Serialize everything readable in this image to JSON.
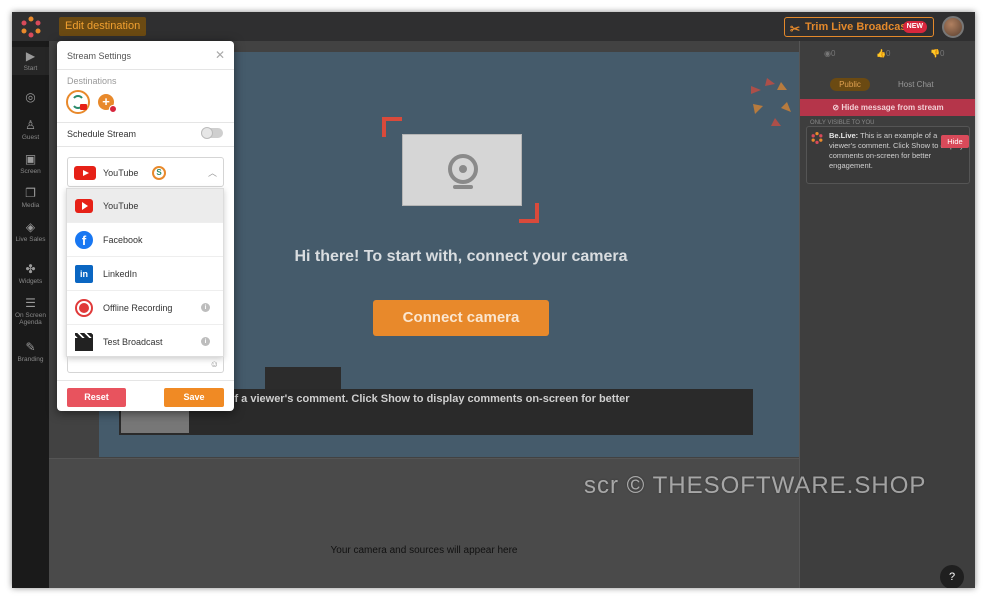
{
  "topbar": {
    "edit_destination": "Edit destination",
    "trim_label": "Trim Live Broadcast",
    "new_badge": "NEW"
  },
  "leftnav": {
    "items": [
      {
        "label": "Start",
        "icon": "play-icon"
      },
      {
        "label": "Guest",
        "icon": "person-icon"
      },
      {
        "label": "Screen",
        "icon": "screen-share-icon"
      },
      {
        "label": "Media",
        "icon": "media-icon"
      },
      {
        "label": "Live Sales",
        "icon": "tag-icon"
      },
      {
        "label": "Widgets",
        "icon": "puzzle-icon"
      },
      {
        "label": "On Screen Agenda",
        "icon": "list-icon"
      },
      {
        "label": "Branding",
        "icon": "brush-icon"
      }
    ]
  },
  "stage": {
    "headline": "Hi there! To start with, connect your camera",
    "connect_button": "Connect camera",
    "comment_preview": "mple of a viewer's comment. Click Show to display comments on-screen for better",
    "sources_text": "Your camera and sources will appear here"
  },
  "rightpanel": {
    "stats": [
      "0",
      "0",
      "0"
    ],
    "tab_public": "Public",
    "tab_host": "Host Chat",
    "hide_bar": "Hide message from stream",
    "only_visible": "ONLY VISIBLE TO YOU",
    "comment_author": "Be.Live:",
    "comment_text": "This is an example of a viewer's comment. Click Show to display comments on-screen for better engagement.",
    "hide_button": "Hide",
    "help": "?"
  },
  "modal": {
    "title": "Stream Settings",
    "destinations_label": "Destinations",
    "schedule_label": "Schedule Stream",
    "selected_platform": "YouTube",
    "menu": [
      {
        "label": "YouTube",
        "icon": "youtube-icon",
        "info": false
      },
      {
        "label": "Facebook",
        "icon": "facebook-icon",
        "info": false
      },
      {
        "label": "LinkedIn",
        "icon": "linkedin-icon",
        "info": false
      },
      {
        "label": "Offline Recording",
        "icon": "record-icon",
        "info": true
      },
      {
        "label": "Test Broadcast",
        "icon": "clapperboard-icon",
        "info": true
      }
    ],
    "reset_label": "Reset",
    "save_label": "Save"
  },
  "watermark": "scr © THESOFTWARE.SHOP",
  "colors": {
    "accent": "#e8892b",
    "danger": "#d94a5a",
    "stage": "#455b6b"
  }
}
